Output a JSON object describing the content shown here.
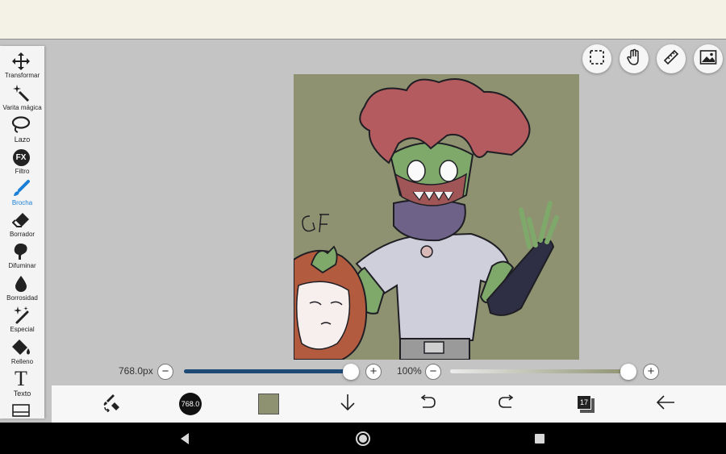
{
  "tools": [
    {
      "label": "Transformar",
      "icon": "move-icon"
    },
    {
      "label": "Varita mágica",
      "icon": "magic-wand-icon"
    },
    {
      "label": "Lazo",
      "icon": "lasso-icon"
    },
    {
      "label": "Filtro",
      "icon": "fx-icon",
      "glyph": "FX"
    },
    {
      "label": "Brocha",
      "icon": "brush-icon",
      "active": true
    },
    {
      "label": "Borrador",
      "icon": "eraser-icon"
    },
    {
      "label": "Difuminar",
      "icon": "smudge-icon"
    },
    {
      "label": "Borrosidad",
      "icon": "blur-drop-icon"
    },
    {
      "label": "Especial",
      "icon": "special-sparkle-icon"
    },
    {
      "label": "Relleno",
      "icon": "fill-bucket-icon"
    },
    {
      "label": "Texto",
      "icon": "text-icon",
      "glyph": "T"
    }
  ],
  "top_buttons": [
    "selection-icon",
    "hand-icon",
    "ruler-icon",
    "image-icon"
  ],
  "brush_size": {
    "label": "768.0px",
    "value_fraction": 1.0
  },
  "opacity": {
    "label": "100%",
    "value_fraction": 1.0
  },
  "bottom_bar": {
    "brush_size_badge": "768.0",
    "layers_count": "17"
  },
  "colors": {
    "accent": "#1a7fd6",
    "canvas_bg": "#8e9270",
    "current_color": "#8e9270",
    "slider_fill": "#1f4a78"
  }
}
